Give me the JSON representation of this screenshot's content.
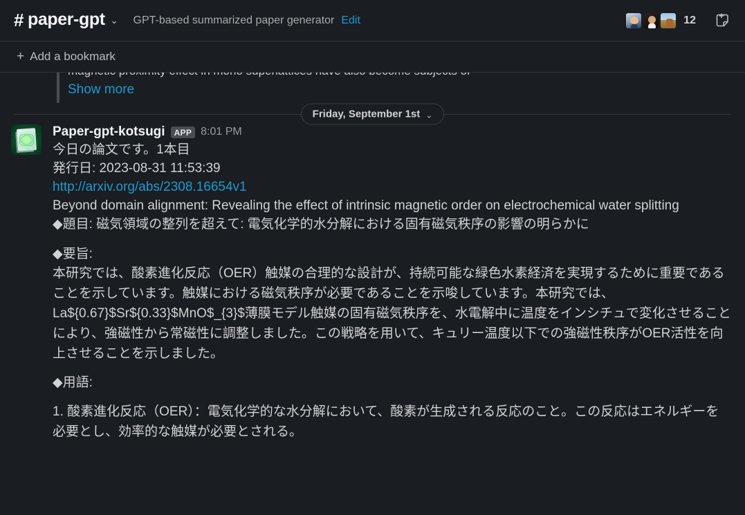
{
  "header": {
    "hash": "#",
    "channel_name": "paper-gpt",
    "chevron": "⌄",
    "topic": "GPT-based summarized paper generator",
    "edit_label": "Edit",
    "member_count": "12",
    "icons": {
      "channel_dropdown": "chevron-down-icon",
      "add_canvas": "add-note-icon"
    }
  },
  "bookmark_bar": {
    "plus": "+",
    "add_bookmark_label": "Add a bookmark"
  },
  "clipped_message": {
    "text": "magnetic proximity effect in mono superlattices have also become subjects of",
    "show_more_label": "Show more"
  },
  "date_divider": {
    "label": "Friday, September 1st",
    "chevron": "⌄"
  },
  "message": {
    "author": "Paper-gpt-kotsugi",
    "app_badge": "APP",
    "timestamp": "8:01 PM",
    "intro_line": "今日の論文です。1本目",
    "published_line": "発行日: 2023-08-31 11:53:39",
    "url": "http://arxiv.org/abs/2308.16654v1",
    "paper_title": "Beyond domain alignment: Revealing the effect of intrinsic magnetic order on electrochemical water splitting",
    "title_ja": "◆題目: 磁気領域の整列を超えて: 電気化学的水分解における固有磁気秩序の影響の明らかに",
    "abstract_heading": "◆要旨:",
    "abstract_body": "本研究では、酸素進化反応（OER）触媒の合理的な設計が、持続可能な緑色水素経済を実現するために重要であることを示しています。触媒における磁気秩序が必要であることを示唆しています。本研究では、La${0.67}$Sr${0.33}$MnO$_{3}$薄膜モデル触媒の固有磁気秩序を、水電解中に温度をインシチュで変化させることにより、強磁性から常磁性に調整しました。この戦略を用いて、キュリー温度以下での強磁性秩序がOER活性を向上させることを示しました。",
    "terms_heading": "◆用語:",
    "term_1": "1. 酸素進化反応（OER）：電気化学的な水分解において、酸素が生成される反応のこと。この反応はエネルギーを必要とし、効率的な触媒が必要とされる。"
  },
  "colors": {
    "background": "#1a1d21",
    "link": "#1d9bd1",
    "text_primary": "#d1d2d3",
    "text_strong": "#f3f4f6",
    "text_muted": "#9a9b9e",
    "border": "#2f3237"
  }
}
